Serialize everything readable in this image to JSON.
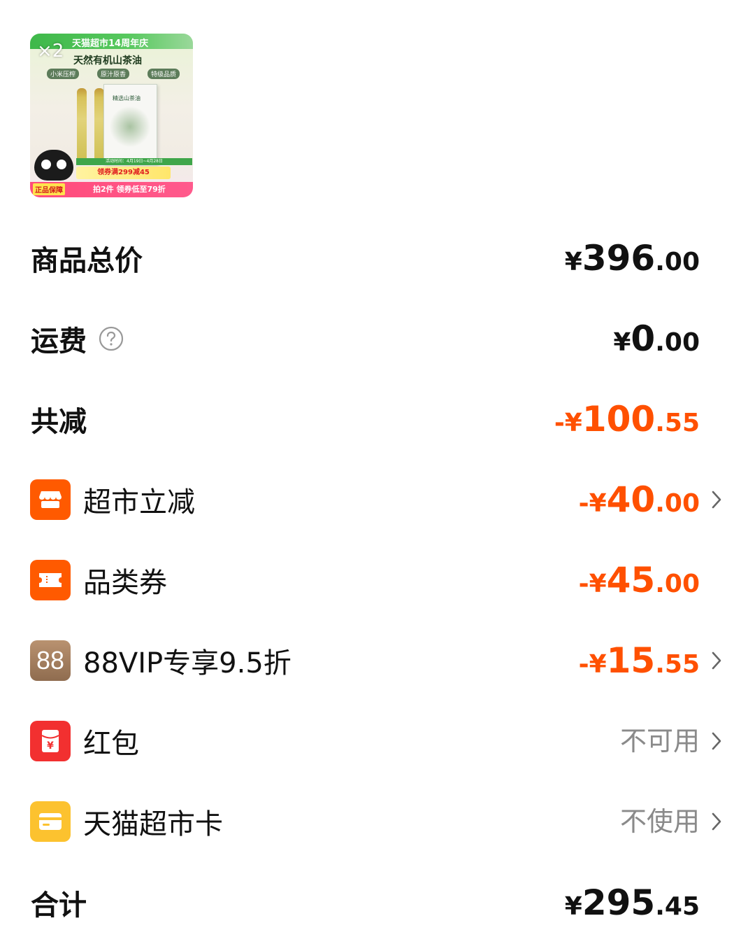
{
  "product": {
    "quantity": "×2",
    "banner_title": "天猫超市14周年庆",
    "headline": "天然有机山茶油",
    "tags": [
      "小米压榨",
      "原汁原香",
      "特级品质"
    ],
    "box_label": "精选山茶油",
    "date_text": "活动时间：4月19日~4月28日",
    "coupon_text": "领券满299减45",
    "guarantee_text": "正品保障",
    "promo_text": "拍2件 领券低至79折"
  },
  "summary": {
    "total": {
      "label": "商品总价",
      "symbol": "¥",
      "int": "396",
      "dec": ".00"
    },
    "shipping": {
      "label": "运费",
      "symbol": "¥",
      "int": "0",
      "dec": ".00"
    },
    "discount": {
      "label": "共减",
      "symbol": "-¥",
      "int": "100",
      "dec": ".55"
    }
  },
  "discounts": [
    {
      "label": "超市立减",
      "symbol": "-¥",
      "int": "40",
      "dec": ".00",
      "icon": "store-icon",
      "icon_color": "#ff5a00"
    },
    {
      "label": "品类券",
      "symbol": "-¥",
      "int": "45",
      "dec": ".00",
      "icon": "ticket-icon",
      "icon_color": "#ff5a00"
    },
    {
      "label": "88VIP专享9.5折",
      "symbol": "-¥",
      "int": "15",
      "dec": ".55",
      "icon": "vip-88-icon",
      "icon_text": "88",
      "icon_color": "#a88563"
    }
  ],
  "options": [
    {
      "label": "红包",
      "status": "不可用",
      "icon": "red-packet-icon",
      "icon_color": "#f23030"
    },
    {
      "label": "天猫超市卡",
      "status": "不使用",
      "icon": "card-icon",
      "icon_color": "#fcc22f"
    }
  ],
  "grand_total": {
    "label": "合计",
    "symbol": "¥",
    "int": "295",
    "dec": ".45"
  },
  "colors": {
    "accent": "#ff5000",
    "muted": "#8a8a8a",
    "text": "#111111"
  }
}
